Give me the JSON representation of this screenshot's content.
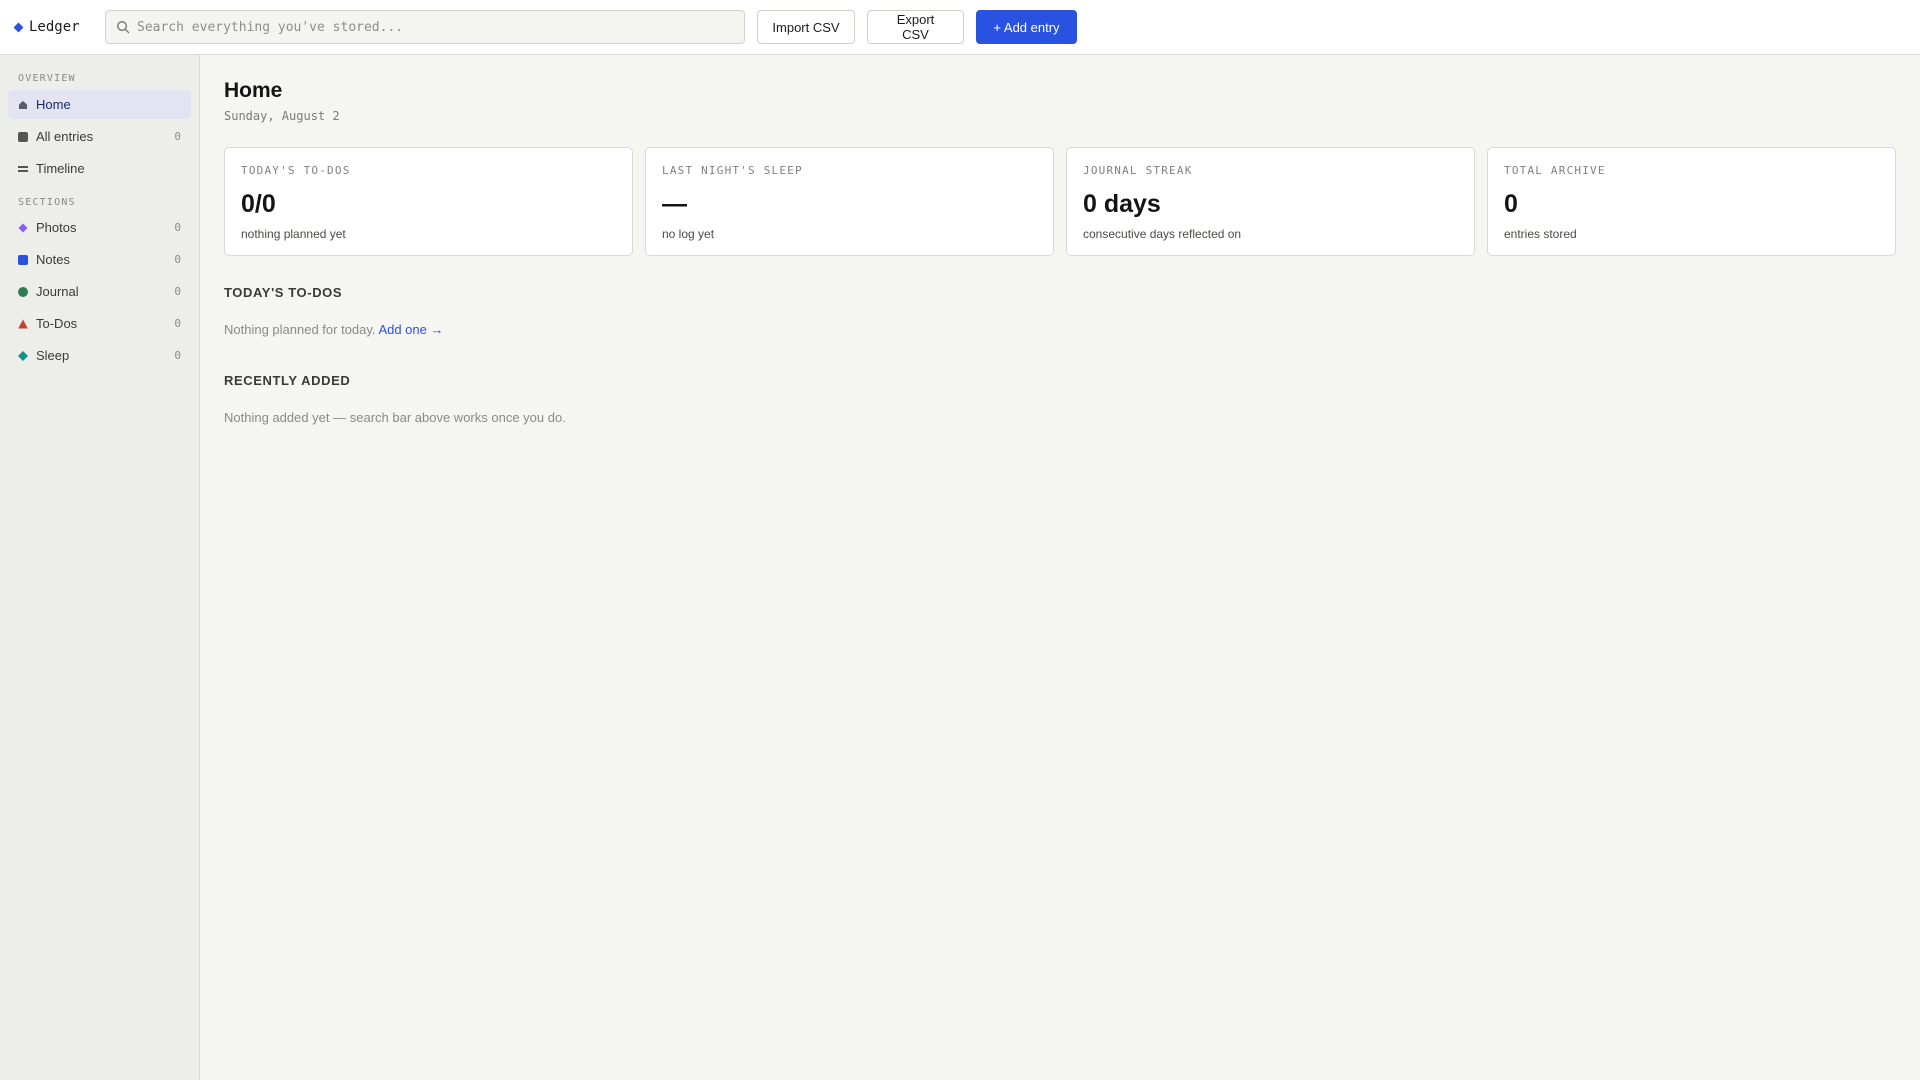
{
  "app": {
    "name": "Ledger",
    "accent": "#2a52e0"
  },
  "topbar": {
    "search_placeholder": "Search everything you've stored...",
    "import_label": "Import CSV",
    "export_label": "Export CSV",
    "add_label": "+ Add entry"
  },
  "sidebar": {
    "overview_heading": "OVERVIEW",
    "overview_items": [
      {
        "label": "Home",
        "icon": "home-icon",
        "count": "",
        "active": true
      },
      {
        "label": "All entries",
        "icon": "square-icon",
        "count": "0"
      },
      {
        "label": "Timeline",
        "icon": "lines-icon",
        "count": ""
      }
    ],
    "sections_heading": "SECTIONS",
    "section_items": [
      {
        "label": "Photos",
        "icon": "diamond-icon",
        "color": "#8b5cf6",
        "count": "0"
      },
      {
        "label": "Notes",
        "icon": "square-icon",
        "color": "#2a52e0",
        "count": "0"
      },
      {
        "label": "Journal",
        "icon": "circle-icon",
        "color": "#2e7d4f",
        "count": "0"
      },
      {
        "label": "To-Dos",
        "icon": "triangle-icon",
        "color": "#c2452d",
        "count": "0"
      },
      {
        "label": "Sleep",
        "icon": "diamond-icon",
        "color": "#14928a",
        "count": "0"
      }
    ]
  },
  "main": {
    "title": "Home",
    "date": "Sunday, August 2",
    "cards": [
      {
        "label": "TODAY'S TO-DOS",
        "value": "0/0",
        "sub": "nothing planned yet"
      },
      {
        "label": "LAST NIGHT'S SLEEP",
        "value": "—",
        "sub": "no log yet"
      },
      {
        "label": "JOURNAL STREAK",
        "value": "0 days",
        "sub": "consecutive days reflected on"
      },
      {
        "label": "TOTAL ARCHIVE",
        "value": "0",
        "sub": "entries stored"
      }
    ],
    "todos_heading": "TODAY'S TO-DOS",
    "todos_empty": "Nothing planned for today.",
    "todos_add_link": "Add one →",
    "recent_heading": "RECENTLY ADDED",
    "recent_empty": "Nothing added yet — search bar above works once you do."
  }
}
